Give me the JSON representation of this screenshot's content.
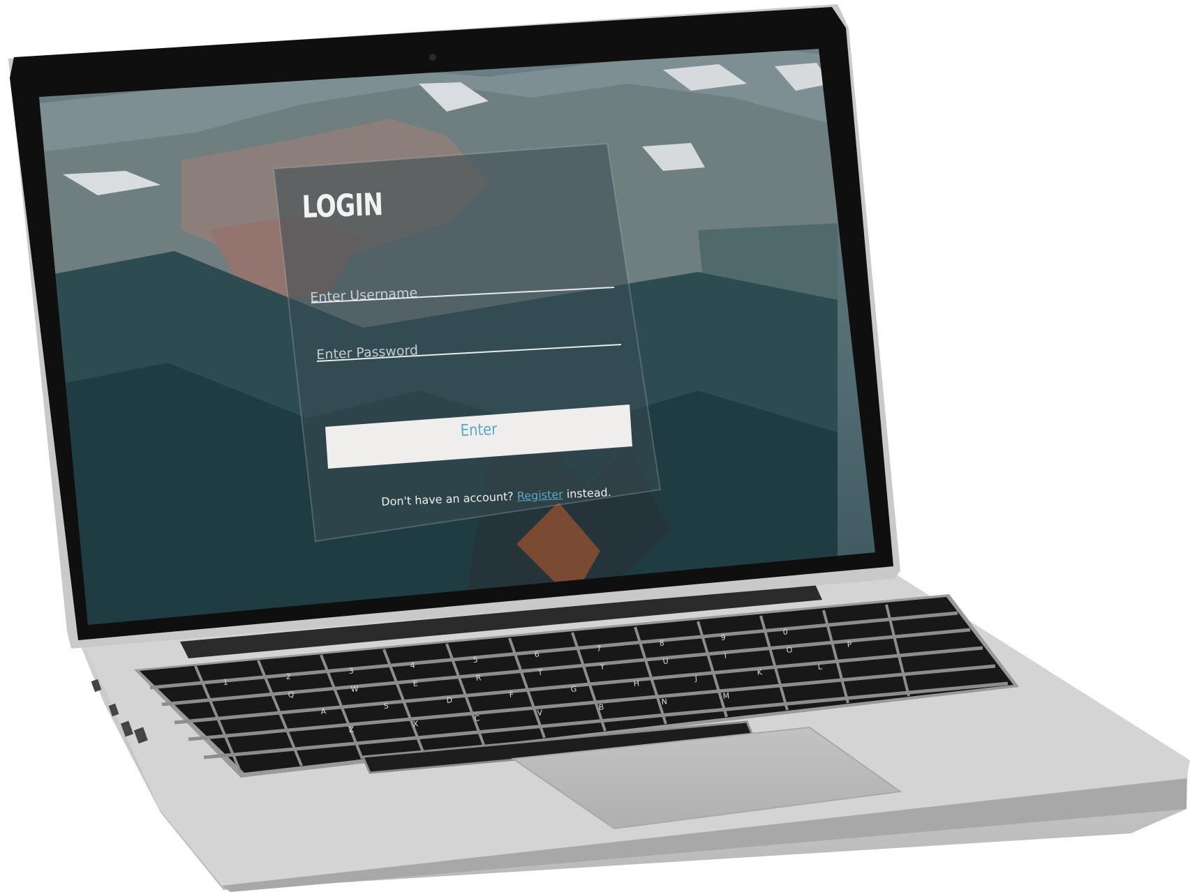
{
  "login": {
    "title": "LOGIN",
    "username_placeholder": "Enter Username",
    "password_placeholder": "Enter Password",
    "submit_label": "Enter",
    "footer_prefix": "Don't have an account? ",
    "register_link": "Register",
    "footer_suffix": " instead."
  },
  "colors": {
    "accent": "#5aa9c8",
    "panel_tint": "#3b4a52",
    "button_background": "#efeeec",
    "laptop_body": "#c9c9c9",
    "screen_bezel": "#0f0f0f"
  }
}
